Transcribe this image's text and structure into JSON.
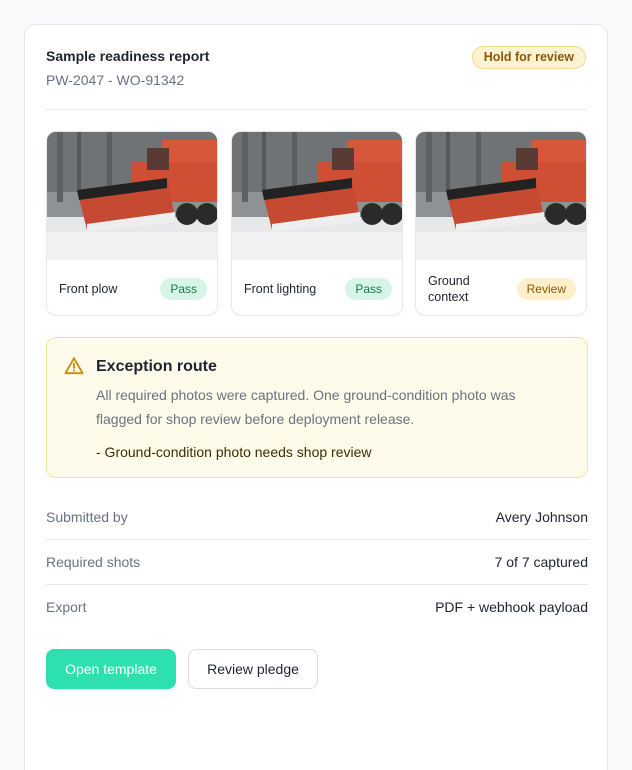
{
  "report": {
    "title": "Sample readiness report",
    "ids": "PW-2047 - WO-91342",
    "status_badge": "Hold for review"
  },
  "photos": [
    {
      "label": "Front plow",
      "status": "Pass",
      "image": "snowplow-truck-photo"
    },
    {
      "label": "Front lighting",
      "status": "Pass",
      "image": "snowplow-truck-photo"
    },
    {
      "label": "Ground context",
      "status": "Review",
      "image": "snowplow-truck-photo"
    }
  ],
  "exception": {
    "icon": "warning-triangle-icon",
    "title": "Exception route",
    "body": "All required photos were captured. One ground-condition photo was flagged for shop review before deployment release.",
    "bullet": "- Ground-condition photo needs shop review"
  },
  "details": [
    {
      "label": "Submitted by",
      "value": "Avery Johnson"
    },
    {
      "label": "Required shots",
      "value": "7 of 7 captured"
    },
    {
      "label": "Export",
      "value": "PDF + webhook payload"
    }
  ],
  "actions": {
    "primary_label": "Open template",
    "secondary_label": "Review pledge"
  },
  "colors": {
    "accent": "#2de0b0",
    "pass_bg": "#d6f5e6",
    "review_bg": "#fcefc9",
    "exception_bg": "#fffbea"
  }
}
